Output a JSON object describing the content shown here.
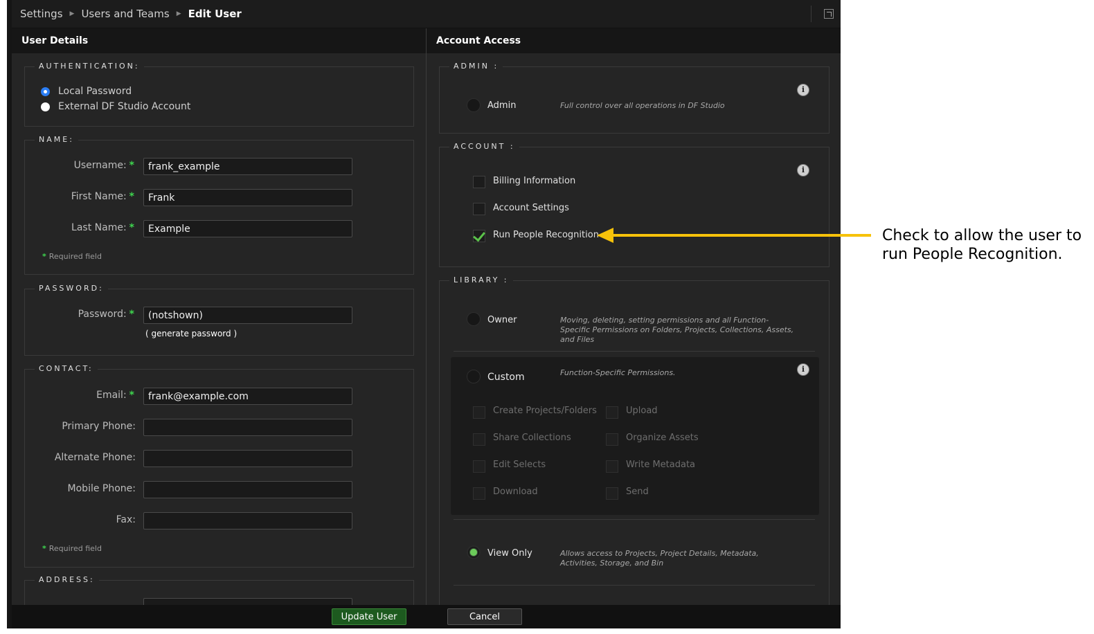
{
  "breadcrumb": [
    "Settings",
    "Users and Teams",
    "Edit User"
  ],
  "left_panel": {
    "title": "User Details",
    "authentication": {
      "legend": "AUTHENTICATION:",
      "options": [
        "Local Password",
        "External DF Studio Account"
      ],
      "selected": "Local Password"
    },
    "name": {
      "legend": "NAME:",
      "username_label": "Username:",
      "username_value": "frank_example",
      "first_name_label": "First Name:",
      "first_name_value": "Frank",
      "last_name_label": "Last Name:",
      "last_name_value": "Example",
      "required_note": "Required field"
    },
    "password": {
      "legend": "PASSWORD:",
      "label": "Password:",
      "value": "(notshown)",
      "generate_link": "( generate password )"
    },
    "contact": {
      "legend": "CONTACT:",
      "email_label": "Email:",
      "email_value": "frank@example.com",
      "primary_phone_label": "Primary Phone:",
      "alternate_phone_label": "Alternate Phone:",
      "mobile_phone_label": "Mobile Phone:",
      "fax_label": "Fax:",
      "required_note": "Required field"
    },
    "address": {
      "legend": "ADDRESS:"
    },
    "required_star": "*"
  },
  "right_panel": {
    "title": "Account Access",
    "admin": {
      "legend": "ADMIN :",
      "label": "Admin",
      "description": "Full control over all operations in DF Studio"
    },
    "account": {
      "legend": "ACCOUNT :",
      "items": [
        {
          "label": "Billing Information",
          "checked": false
        },
        {
          "label": "Account Settings",
          "checked": false
        },
        {
          "label": "Run People Recognition",
          "checked": true
        }
      ]
    },
    "library": {
      "legend": "LIBRARY :",
      "owner_label": "Owner",
      "owner_description": "Moving, deleting, setting permissions and all Function-Specific Permissions on Folders, Projects, Collections, Assets, and Files",
      "custom_label": "Custom",
      "custom_description": "Function-Specific Permissions.",
      "custom_items": [
        "Create Projects/Folders",
        "Upload",
        "Share Collections",
        "Organize Assets",
        "Edit Selects",
        "Write Metadata",
        "Download",
        "Send"
      ],
      "view_only_label": "View Only",
      "view_only_description": "Allows access to Projects, Project Details, Metadata, Activities, Storage, and Bin",
      "selected": "View Only"
    },
    "info_glyph": "i"
  },
  "footer": {
    "update_label": "Update User",
    "cancel_label": "Cancel"
  },
  "annotation": {
    "text": "Check to allow the user to run People Recognition."
  },
  "colors": {
    "accent_green": "#5bc24a",
    "arrow_yellow": "#f7c20a",
    "radio_blue": "#2b7ef5",
    "panel_bg": "#252525"
  }
}
